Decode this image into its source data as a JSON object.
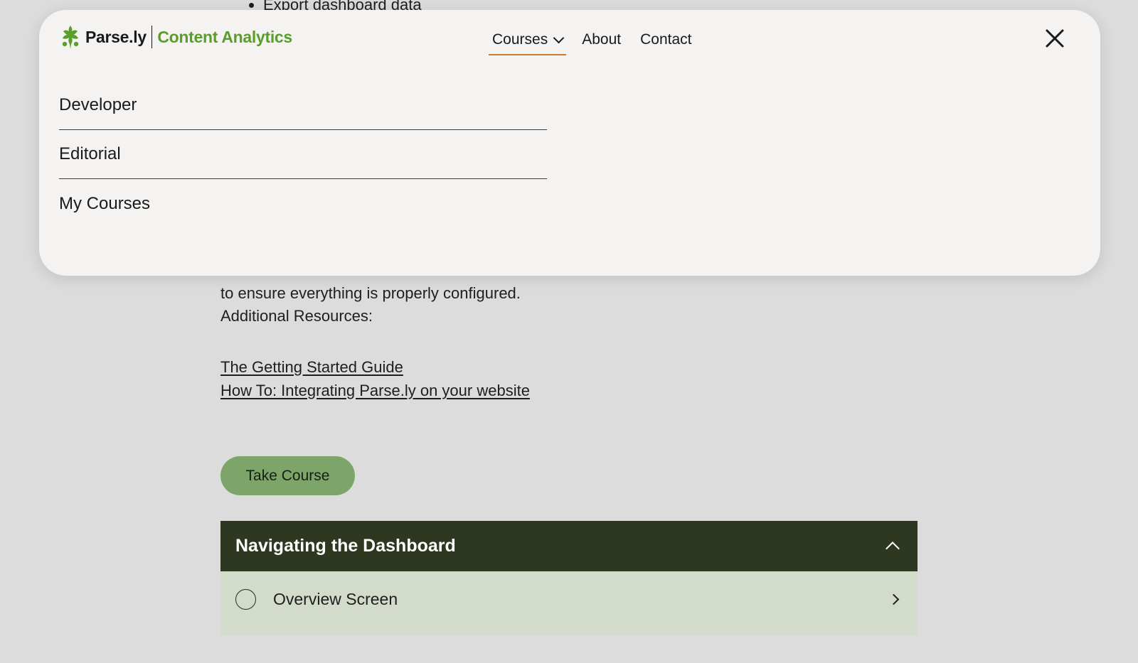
{
  "background": {
    "bullet_text": "Export dashboard data",
    "paragraph_tail": "to ensure everything is properly configured.",
    "resources_label": "Additional Resources:",
    "links": [
      "The Getting Started Guide",
      "How To: Integrating Parse.ly on your website"
    ],
    "take_course_label": "Take Course",
    "accordion": {
      "title": "Navigating the Dashboard",
      "lessons": [
        "Overview Screen"
      ]
    }
  },
  "header": {
    "brand_name": "Parse.ly",
    "product_name": "Content Analytics",
    "nav": [
      {
        "label": "Courses",
        "active": true
      },
      {
        "label": "About",
        "active": false
      },
      {
        "label": "Contact",
        "active": false
      }
    ],
    "close_icon": "close-icon"
  },
  "dropdown": {
    "items": [
      "Developer",
      "Editorial",
      "My Courses"
    ]
  },
  "colors": {
    "brand_green": "#5a9e2a",
    "nav_active_underline": "#c87a2e",
    "button_green": "#7da56a",
    "accordion_header": "#2e3820",
    "lesson_row": "#d3dccb",
    "panel_bg": "#f4f3f1",
    "page_overlay": "#dcdcdc"
  }
}
